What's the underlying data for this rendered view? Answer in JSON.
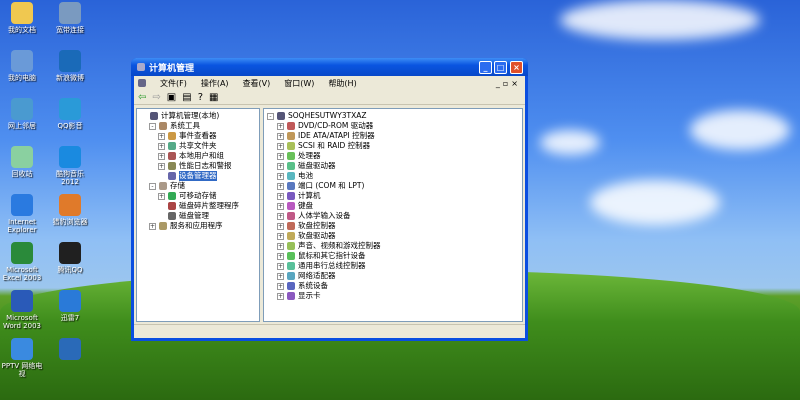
{
  "desktop": [
    {
      "label": "我的文档",
      "color": "#f0c850"
    },
    {
      "label": "宽带连接",
      "color": "#7a9ac0"
    },
    {
      "label": "我的电脑",
      "color": "#6a9ad8"
    },
    {
      "label": "新浪微博",
      "color": "#1a6ab8"
    },
    {
      "label": "网上邻居",
      "color": "#4a9ad0"
    },
    {
      "label": "QQ影音",
      "color": "#2a9ad8"
    },
    {
      "label": "回收站",
      "color": "#8ad0a0"
    },
    {
      "label": "酷狗音乐 2012",
      "color": "#1a8ae0"
    },
    {
      "label": "Internet Explorer",
      "color": "#2a7ae0"
    },
    {
      "label": "猎豹浏览器",
      "color": "#e07a2a"
    },
    {
      "label": "Microsoft Excel 2003",
      "color": "#2a8a3a"
    },
    {
      "label": "腾讯QQ",
      "color": "#202020"
    },
    {
      "label": "Microsoft Word 2003",
      "color": "#2a5ab8"
    },
    {
      "label": "迅雷7",
      "color": "#2a7ad8"
    },
    {
      "label": "PPTV 网络电视",
      "color": "#3a8ae0"
    },
    {
      "label": "",
      "color": "#2a6ab8"
    }
  ],
  "window": {
    "title": "计算机管理",
    "menu": [
      "文件(F)",
      "操作(A)",
      "查看(V)",
      "窗口(W)",
      "帮助(H)"
    ],
    "tree": [
      {
        "label": "计算机管理(本地)",
        "level": 0,
        "pm": ""
      },
      {
        "label": "系统工具",
        "level": 1,
        "pm": "-"
      },
      {
        "label": "事件查看器",
        "level": 2,
        "pm": "+"
      },
      {
        "label": "共享文件夹",
        "level": 2,
        "pm": "+"
      },
      {
        "label": "本地用户和组",
        "level": 2,
        "pm": "+"
      },
      {
        "label": "性能日志和警报",
        "level": 2,
        "pm": "+"
      },
      {
        "label": "设备管理器",
        "level": 2,
        "pm": "",
        "selected": true
      },
      {
        "label": "存储",
        "level": 1,
        "pm": "-"
      },
      {
        "label": "可移动存储",
        "level": 2,
        "pm": "+"
      },
      {
        "label": "磁盘碎片整理程序",
        "level": 2,
        "pm": ""
      },
      {
        "label": "磁盘管理",
        "level": 2,
        "pm": ""
      },
      {
        "label": "服务和应用程序",
        "level": 1,
        "pm": "+"
      }
    ],
    "computer": "SOQHESUTWY3TXAZ",
    "devices": [
      "DVD/CD-ROM 驱动器",
      "IDE ATA/ATAPI 控制器",
      "SCSI 和 RAID 控制器",
      "处理器",
      "磁盘驱动器",
      "电池",
      "端口 (COM 和 LPT)",
      "计算机",
      "键盘",
      "人体学输入设备",
      "软盘控制器",
      "软盘驱动器",
      "声音、视频和游戏控制器",
      "鼠标和其它指针设备",
      "通用串行总线控制器",
      "网络适配器",
      "系统设备",
      "显示卡"
    ]
  }
}
